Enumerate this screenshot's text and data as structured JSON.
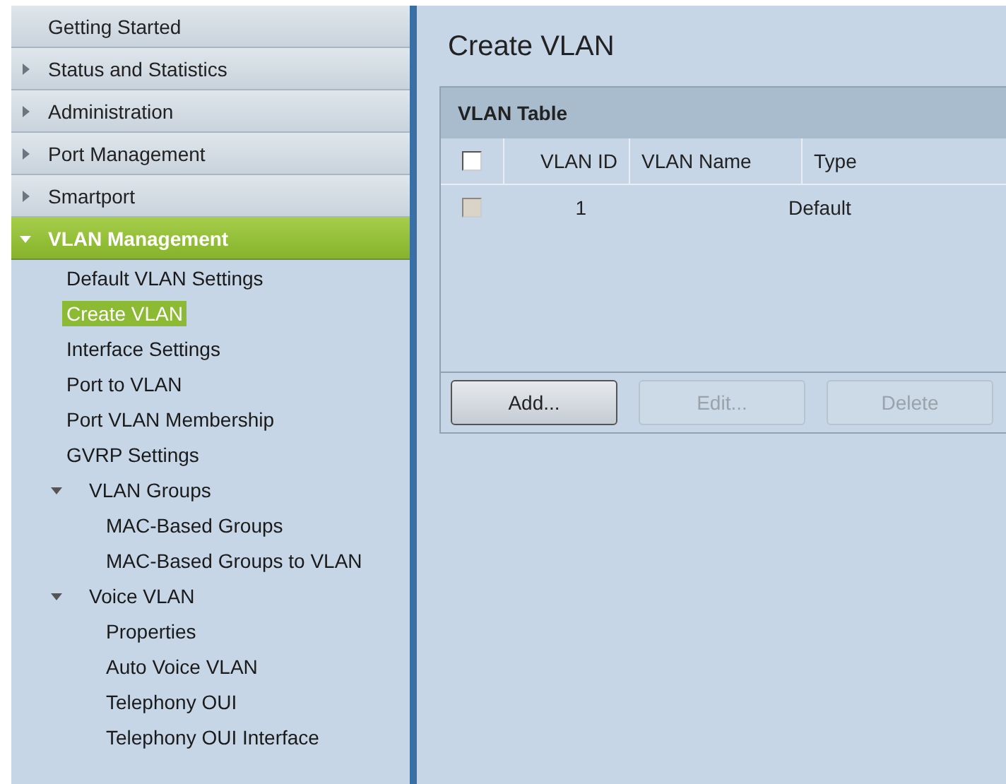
{
  "sidebar": {
    "items": [
      {
        "label": "Getting Started",
        "selected": false
      },
      {
        "label": "Status and Statistics",
        "selected": false,
        "expanded": false
      },
      {
        "label": "Administration",
        "selected": false,
        "expanded": false
      },
      {
        "label": "Port Management",
        "selected": false,
        "expanded": false
      },
      {
        "label": "Smartport",
        "selected": false,
        "expanded": false
      },
      {
        "label": "VLAN Management",
        "selected": true,
        "expanded": true,
        "children": [
          {
            "label": "Default VLAN Settings",
            "selected": false
          },
          {
            "label": "Create VLAN",
            "selected": true
          },
          {
            "label": "Interface Settings",
            "selected": false
          },
          {
            "label": "Port to VLAN",
            "selected": false
          },
          {
            "label": "Port VLAN Membership",
            "selected": false
          },
          {
            "label": "GVRP Settings",
            "selected": false
          },
          {
            "label": "VLAN Groups",
            "selected": false,
            "expanded": true,
            "children": [
              {
                "label": "MAC-Based Groups",
                "selected": false
              },
              {
                "label": "MAC-Based Groups to VLAN",
                "selected": false
              }
            ]
          },
          {
            "label": "Voice VLAN",
            "selected": false,
            "expanded": true,
            "children": [
              {
                "label": "Properties",
                "selected": false
              },
              {
                "label": "Auto Voice VLAN",
                "selected": false
              },
              {
                "label": "Telephony OUI",
                "selected": false
              },
              {
                "label": "Telephony OUI Interface",
                "selected": false
              }
            ]
          }
        ]
      }
    ]
  },
  "page": {
    "title": "Create VLAN"
  },
  "table": {
    "title": "VLAN Table",
    "select_all": {
      "checked": false,
      "disabled": false
    },
    "columns": [
      "VLAN ID",
      "VLAN Name",
      "Type"
    ],
    "rows": [
      {
        "checked": false,
        "disabled": true,
        "cells": [
          "1",
          "",
          "Default"
        ]
      }
    ],
    "buttons": [
      {
        "label": "Add...",
        "disabled": false
      },
      {
        "label": "Edit...",
        "disabled": true
      },
      {
        "label": "Delete",
        "disabled": true
      }
    ]
  }
}
